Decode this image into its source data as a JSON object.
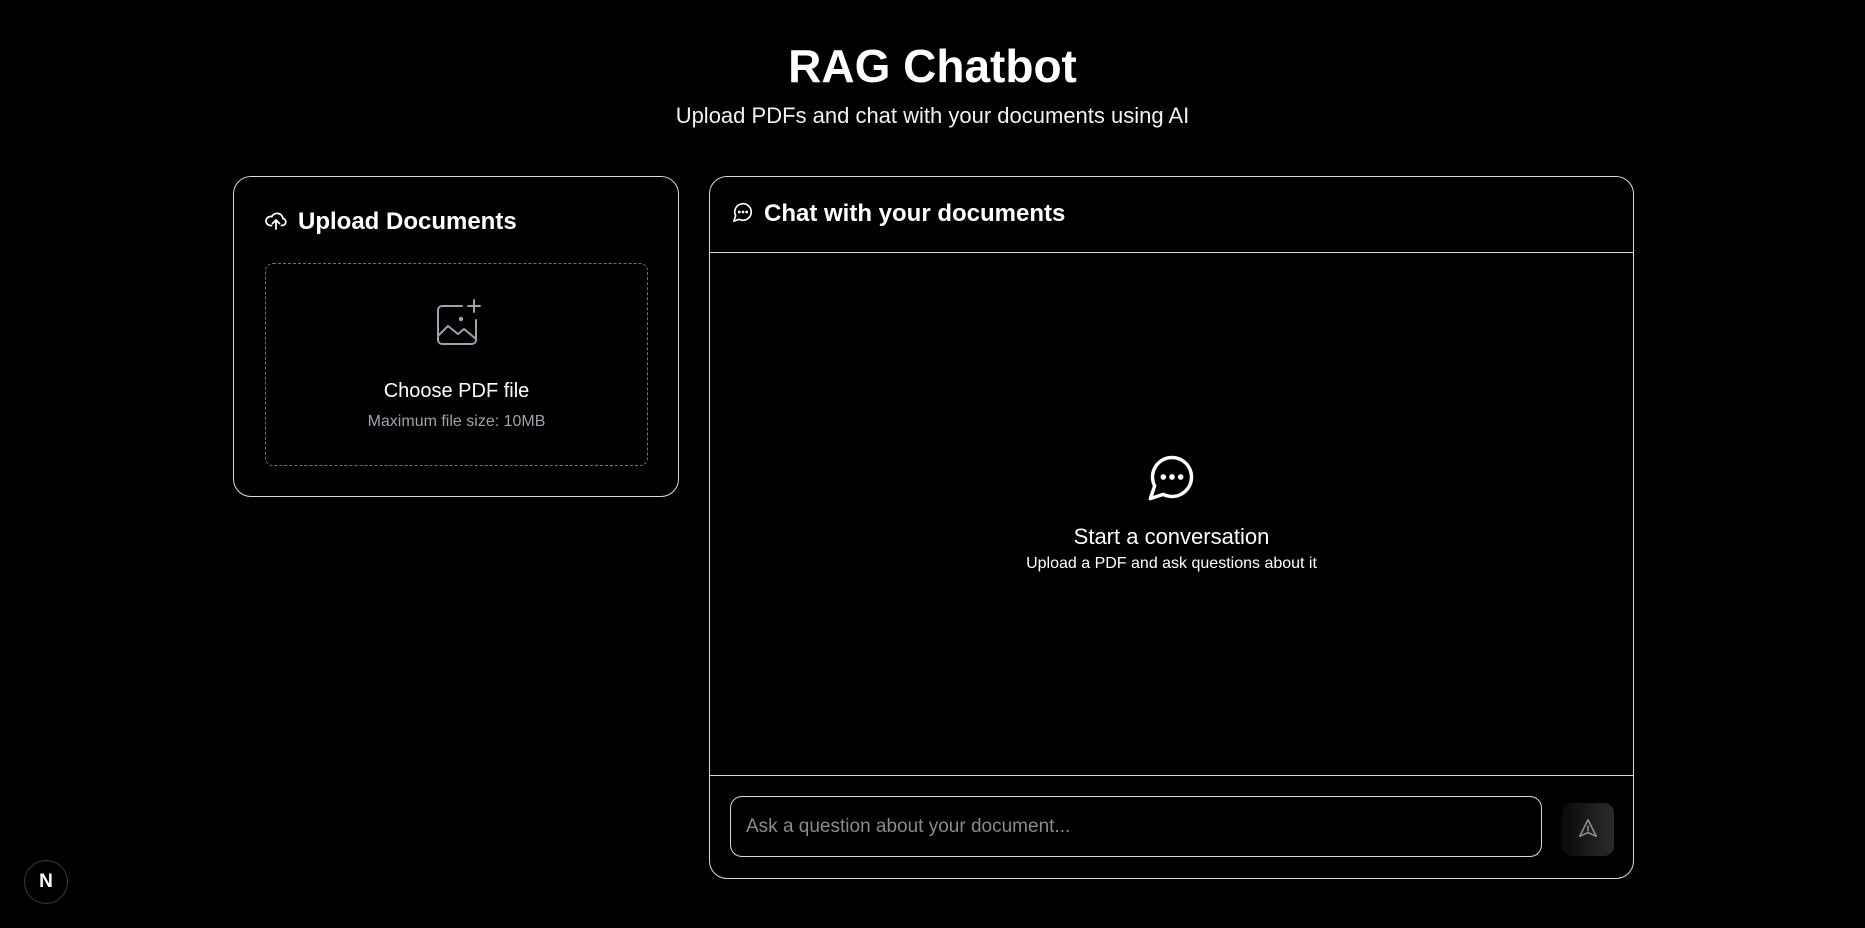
{
  "header": {
    "title": "RAG Chatbot",
    "subtitle": "Upload PDFs and chat with your documents using AI"
  },
  "upload": {
    "title": "Upload Documents",
    "icon": "cloud-upload-icon",
    "dropzone_label": "Choose PDF file",
    "dropzone_hint": "Maximum file size: 10MB",
    "dropzone_icon": "image-plus-icon"
  },
  "chat": {
    "title": "Chat with your documents",
    "icon": "message-circle-icon",
    "empty_title": "Start a conversation",
    "empty_subtitle": "Upload a PDF and ask questions about it",
    "input_placeholder": "Ask a question about your document...",
    "input_value": "",
    "send_icon": "send-icon"
  },
  "dev_badge": {
    "label": "N",
    "icon": "nextjs-icon"
  },
  "colors": {
    "background": "#000000",
    "border": "#d9d9d9",
    "dashed_border": "#6b7280",
    "muted_text": "#9ca3af",
    "placeholder": "#8a8a8a"
  }
}
